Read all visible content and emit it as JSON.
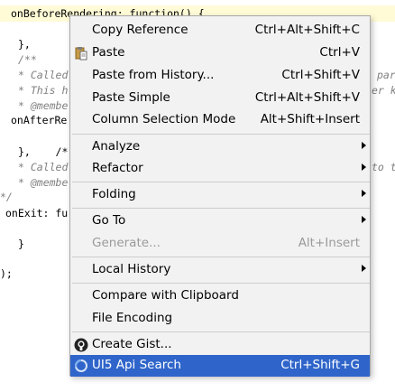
{
  "editor": {
    "lines": [
      {
        "text": "onBeforeRendering: function() {",
        "kind": "plain"
      },
      {
        "text": "},",
        "kind": "plain"
      },
      {
        "text": "/**",
        "kind": "comment"
      },
      {
        "text": "* Called",
        "kind": "comment"
      },
      {
        "text": "* This h",
        "kind": "comment"
      },
      {
        "text": "* @membe",
        "kind": "comment"
      },
      {
        "text": "onAfterRe",
        "kind": "plain"
      },
      {
        "text": "},    /*",
        "kind": "plain"
      },
      {
        "text": "* Called",
        "kind": "comment"
      },
      {
        "text": "* @membe",
        "kind": "comment"
      },
      {
        "text": "*/",
        "kind": "comment"
      },
      {
        "text": "onExit: fu",
        "kind": "plain"
      },
      {
        "text": "}",
        "kind": "plain"
      },
      {
        "text": ");",
        "kind": "plain"
      }
    ],
    "right_fragments": [
      {
        "text": "par",
        "kind": "comment"
      },
      {
        "text": "er k",
        "kind": "comment"
      },
      {
        "text": "to t",
        "kind": "comment"
      }
    ]
  },
  "menu": {
    "items": [
      {
        "id": "copy-reference",
        "label": "Copy Reference",
        "shortcut": "Ctrl+Alt+Shift+C",
        "icon": "",
        "submenu": false,
        "disabled": false,
        "selected": false
      },
      {
        "id": "paste",
        "label": "Paste",
        "shortcut": "Ctrl+V",
        "icon": "clipboard-icon",
        "submenu": false,
        "disabled": false,
        "selected": false
      },
      {
        "id": "paste-from-history",
        "label": "Paste from History...",
        "shortcut": "Ctrl+Shift+V",
        "icon": "",
        "submenu": false,
        "disabled": false,
        "selected": false
      },
      {
        "id": "paste-simple",
        "label": "Paste Simple",
        "shortcut": "Ctrl+Alt+Shift+V",
        "icon": "",
        "submenu": false,
        "disabled": false,
        "selected": false
      },
      {
        "id": "column-selection-mode",
        "label": "Column Selection Mode",
        "shortcut": "Alt+Shift+Insert",
        "icon": "",
        "submenu": false,
        "disabled": false,
        "selected": false
      },
      {
        "id": "analyze",
        "label": "Analyze",
        "shortcut": "",
        "icon": "",
        "submenu": true,
        "disabled": false,
        "selected": false
      },
      {
        "id": "refactor",
        "label": "Refactor",
        "shortcut": "",
        "icon": "",
        "submenu": true,
        "disabled": false,
        "selected": false
      },
      {
        "id": "folding",
        "label": "Folding",
        "shortcut": "",
        "icon": "",
        "submenu": true,
        "disabled": false,
        "selected": false
      },
      {
        "id": "go-to",
        "label": "Go To",
        "shortcut": "",
        "icon": "",
        "submenu": true,
        "disabled": false,
        "selected": false
      },
      {
        "id": "generate",
        "label": "Generate...",
        "shortcut": "Alt+Insert",
        "icon": "",
        "submenu": false,
        "disabled": true,
        "selected": false
      },
      {
        "id": "local-history",
        "label": "Local History",
        "shortcut": "",
        "icon": "",
        "submenu": true,
        "disabled": false,
        "selected": false
      },
      {
        "id": "compare-with-clipboard",
        "label": "Compare with Clipboard",
        "shortcut": "",
        "icon": "",
        "submenu": false,
        "disabled": false,
        "selected": false
      },
      {
        "id": "file-encoding",
        "label": "File Encoding",
        "shortcut": "",
        "icon": "",
        "submenu": false,
        "disabled": false,
        "selected": false
      },
      {
        "id": "create-gist",
        "label": "Create Gist...",
        "shortcut": "",
        "icon": "github-icon",
        "submenu": false,
        "disabled": false,
        "selected": false
      },
      {
        "id": "ui5-api-search",
        "label": "UI5 Api Search",
        "shortcut": "Ctrl+Shift+G",
        "icon": "spinner-icon",
        "submenu": false,
        "disabled": false,
        "selected": true
      }
    ],
    "colors": {
      "selected_bg": "#2f65ca",
      "menu_bg": "#f2f2f2",
      "disabled_text": "#9a9a9a"
    }
  }
}
